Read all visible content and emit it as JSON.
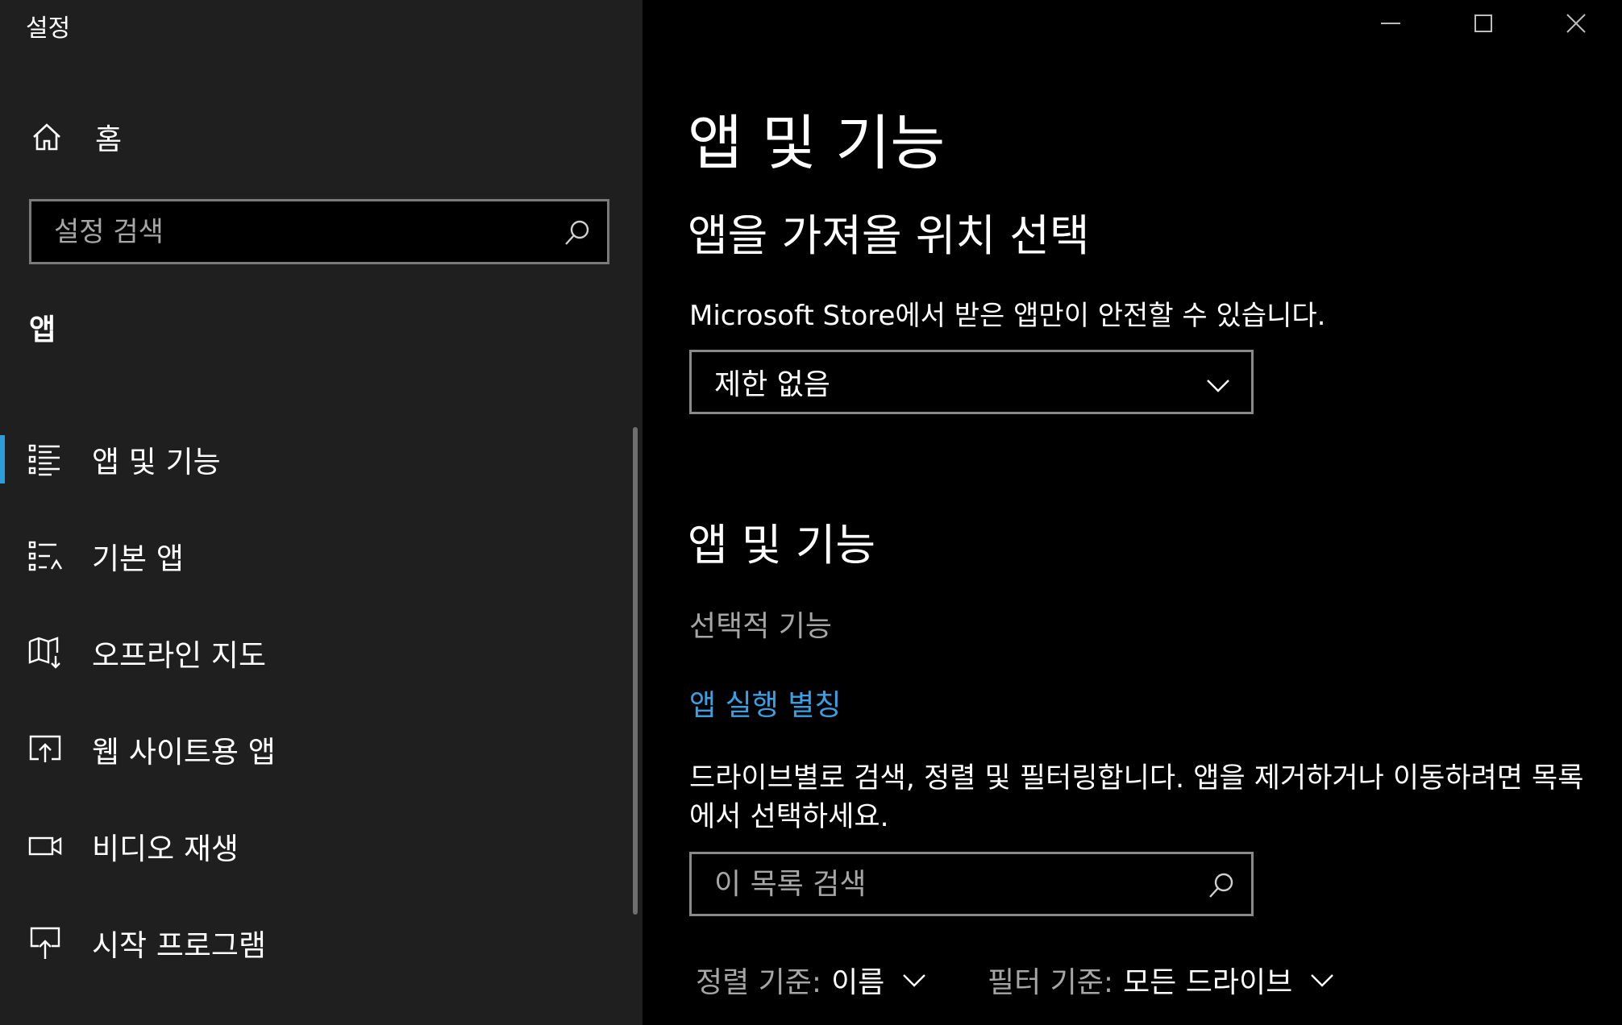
{
  "window": {
    "title": "설정",
    "minimize_icon": "minimize-icon",
    "maximize_icon": "maximize-icon",
    "close_icon": "close-icon"
  },
  "sidebar": {
    "home_label": "홈",
    "search_placeholder": "설정 검색",
    "section_heading": "앱",
    "items": [
      {
        "label": "앱 및 기능",
        "icon": "apps-features-icon",
        "active": true
      },
      {
        "label": "기본 앱",
        "icon": "default-apps-icon",
        "active": false
      },
      {
        "label": "오프라인 지도",
        "icon": "offline-maps-icon",
        "active": false
      },
      {
        "label": "웹 사이트용 앱",
        "icon": "apps-for-websites-icon",
        "active": false
      },
      {
        "label": "비디오 재생",
        "icon": "video-playback-icon",
        "active": false
      },
      {
        "label": "시작 프로그램",
        "icon": "startup-icon",
        "active": false
      }
    ]
  },
  "main": {
    "page_title": "앱 및 기능",
    "install_section": {
      "heading": "앱을 가져올 위치 선택",
      "description": "Microsoft Store에서 받은 앱만이 안전할 수 있습니다.",
      "dropdown_value": "제한 없음"
    },
    "apps_section": {
      "heading": "앱 및 기능",
      "optional_features_link": "선택적 기능",
      "app_alias_link": "앱 실행 별칭",
      "description": "드라이브별로 검색, 정렬 및 필터링합니다. 앱을 제거하거나 이동하려면 목록에서 선택하세요.",
      "search_placeholder": "이 목록 검색",
      "sort_key": "정렬 기준:",
      "sort_value": "이름",
      "filter_key": "필터 기준:",
      "filter_value": "모든 드라이브"
    }
  },
  "colors": {
    "sidebar_bg": "#1f1f1f",
    "main_bg": "#000000",
    "accent": "#2d9cdb",
    "link": "#3aa0e4",
    "secondary_text": "#a6a6a6"
  }
}
